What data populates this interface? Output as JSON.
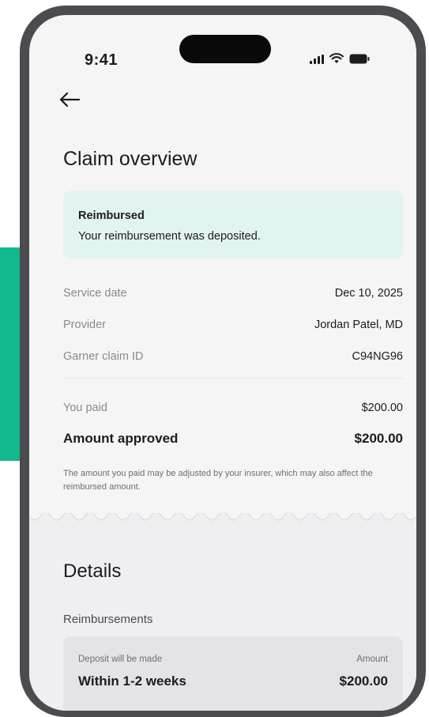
{
  "status_bar": {
    "time": "9:41",
    "signal_icon": "cellular-signal-icon",
    "wifi_icon": "wifi-icon",
    "battery_icon": "battery-icon"
  },
  "nav": {
    "back_icon": "back-arrow-icon"
  },
  "page": {
    "title": "Claim overview"
  },
  "status_card": {
    "title": "Reimbursed",
    "message": "Your reimbursement was deposited.",
    "background": "#e2f4ef"
  },
  "claim_info": [
    {
      "label": "Service date",
      "value": "Dec 10, 2025"
    },
    {
      "label": "Provider",
      "value": "Jordan Patel, MD"
    },
    {
      "label": "Garner claim ID",
      "value": "C94NG96"
    }
  ],
  "amounts": {
    "paid_label": "You paid",
    "paid_value": "$200.00",
    "approved_label": "Amount approved",
    "approved_value": "$200.00"
  },
  "disclaimer": "The amount you paid may be adjusted by your insurer, which may also affect the reimbursed amount.",
  "details": {
    "title": "Details",
    "section_label": "Reimbursements",
    "deposit_label": "Deposit will be made",
    "deposit_value": "Within 1-2 weeks",
    "amount_label": "Amount",
    "amount_value": "$200.00"
  },
  "colors": {
    "accent": "#13b98e",
    "phone_frame": "#4b4c50"
  }
}
